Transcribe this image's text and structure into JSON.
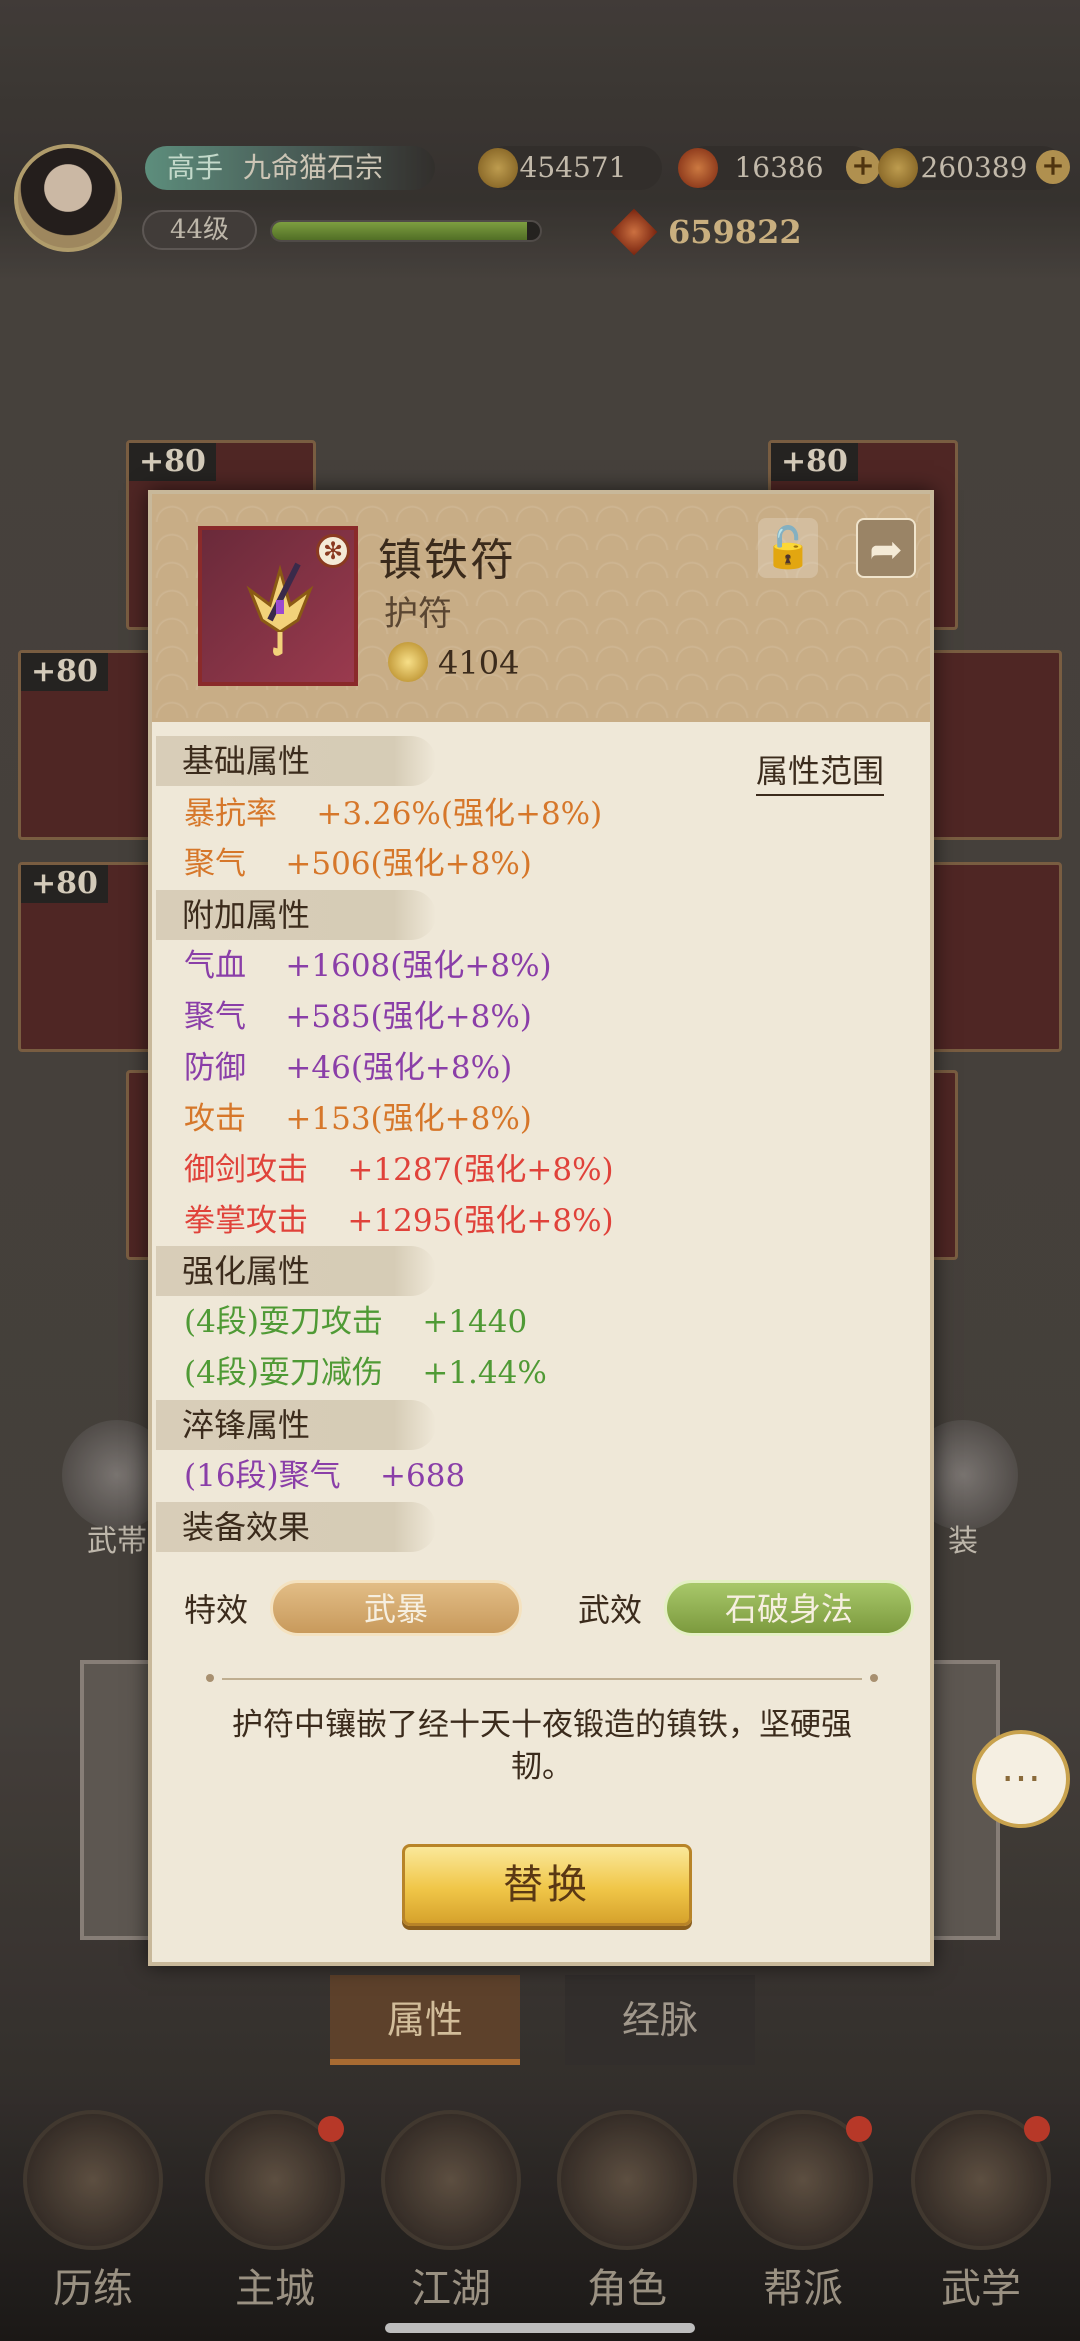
{
  "player": {
    "rank": "高手",
    "name": "九命猫石宗",
    "level": "44级",
    "exp_progress": 0.95,
    "power": "659822"
  },
  "resources": [
    {
      "icon": "coin-icon",
      "value": "454571"
    },
    {
      "icon": "flame-gem-icon",
      "value": "16386"
    },
    {
      "icon": "gold-ingot-icon",
      "value": "260389"
    }
  ],
  "equip_slots": {
    "level_label": "+80"
  },
  "side_buttons": {
    "left": "武帯",
    "right": "装"
  },
  "item": {
    "name": "镇铁符",
    "type": "护符",
    "score": "4104",
    "attr_range_label": "属性范围"
  },
  "sections": {
    "base": "基础属性",
    "extra": "附加属性",
    "enhance": "强化属性",
    "temper": "淬锋属性",
    "effect": "装备效果"
  },
  "base_stats": [
    {
      "text": "暴抗率    +3.26%(强化+8%)",
      "color": "#d6772a"
    },
    {
      "text": "聚气    +506(强化+8%)",
      "color": "#d6772a"
    }
  ],
  "extra_stats": [
    {
      "text": "气血    +1608(强化+8%)",
      "color": "#8a3ea8"
    },
    {
      "text": "聚气    +585(强化+8%)",
      "color": "#8a3ea8"
    },
    {
      "text": "防御    +46(强化+8%)",
      "color": "#8a3ea8"
    },
    {
      "text": "攻击    +153(强化+8%)",
      "color": "#d6772a"
    },
    {
      "text": "御剑攻击    +1287(强化+8%)",
      "color": "#e0423a"
    },
    {
      "text": "拳掌攻击    +1295(强化+8%)",
      "color": "#e0423a"
    }
  ],
  "enhance_stats": [
    {
      "text": "(4段)耍刀攻击    +1440",
      "color": "#4f9a35"
    },
    {
      "text": "(4段)耍刀减伤    +1.44%",
      "color": "#4f9a35"
    }
  ],
  "temper_stats": [
    {
      "text": "(16段)聚气    +688",
      "color": "#8a3ea8"
    }
  ],
  "effects": {
    "special_label": "特效",
    "special_value": "武暴",
    "martial_label": "武效",
    "martial_value": "石破身法"
  },
  "description": "护符中镶嵌了经十天十夜锻造的镇铁，坚硬强韧。",
  "replace_button": "替换",
  "tabs": [
    "属性",
    "经脉"
  ],
  "nav": [
    "历练",
    "主城",
    "江湖",
    "角色",
    "帮派",
    "武学"
  ],
  "colors": {
    "accent_gold": "#f0c648",
    "panel_bg": "#efe8d8",
    "header_bg": "#c8ad86"
  }
}
